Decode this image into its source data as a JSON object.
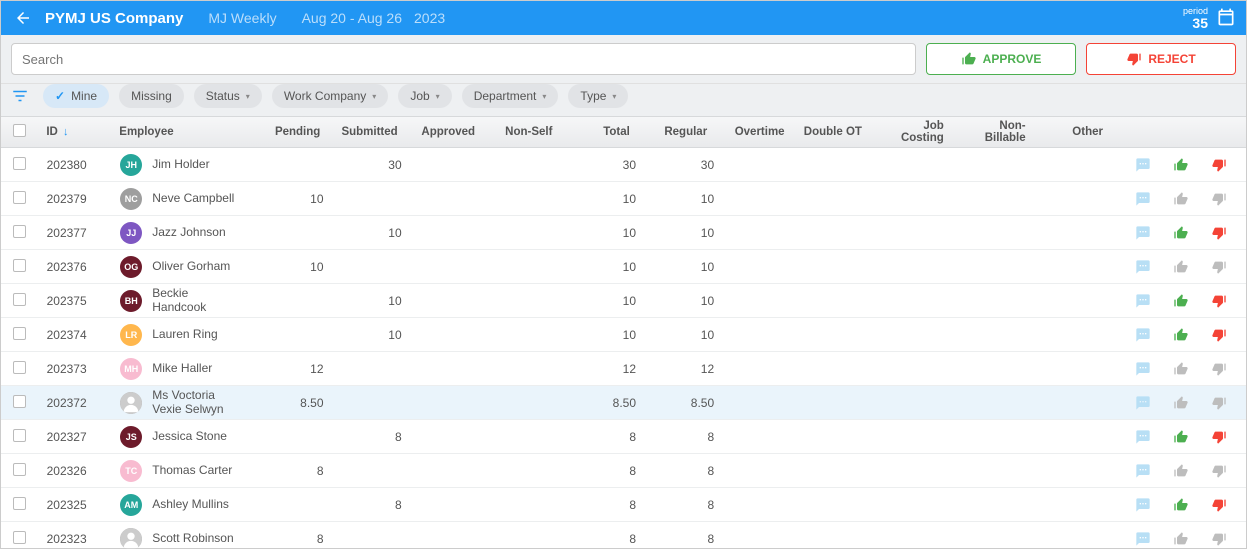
{
  "header": {
    "company": "PYMJ US Company",
    "period_name": "MJ Weekly",
    "date_range": "Aug 20 - Aug 26",
    "year": "2023",
    "period_label": "period",
    "period_number": "35"
  },
  "toolbar": {
    "search_placeholder": "Search",
    "approve_label": "APPROVE",
    "reject_label": "REJECT"
  },
  "filters": {
    "mine": "Mine",
    "chips": [
      {
        "label": "Missing",
        "dropdown": false
      },
      {
        "label": "Status",
        "dropdown": true
      },
      {
        "label": "Work Company",
        "dropdown": true
      },
      {
        "label": "Job",
        "dropdown": true
      },
      {
        "label": "Department",
        "dropdown": true
      },
      {
        "label": "Type",
        "dropdown": true
      }
    ]
  },
  "columns": {
    "id": "ID",
    "employee": "Employee",
    "pending": "Pending",
    "submitted": "Submitted",
    "approved": "Approved",
    "nonself": "Non-Self",
    "total": "Total",
    "regular": "Regular",
    "overtime": "Overtime",
    "doubleot": "Double OT",
    "jobcosting": "Job Costing",
    "nonbillable": "Non-Billable",
    "other": "Other"
  },
  "rows": [
    {
      "id": "202380",
      "initials": "JH",
      "name": "Jim Holder",
      "color": "#26a69a",
      "pending": "",
      "submitted": "30",
      "total": "30",
      "regular": "30",
      "up": true,
      "down": true,
      "photo": false
    },
    {
      "id": "202379",
      "initials": "NC",
      "name": "Neve Campbell",
      "color": "#9e9e9e",
      "pending": "10",
      "submitted": "",
      "total": "10",
      "regular": "10",
      "up": false,
      "down": false,
      "photo": false
    },
    {
      "id": "202377",
      "initials": "JJ",
      "name": "Jazz Johnson",
      "color": "#7e57c2",
      "pending": "",
      "submitted": "10",
      "total": "10",
      "regular": "10",
      "up": true,
      "down": true,
      "photo": false
    },
    {
      "id": "202376",
      "initials": "OG",
      "name": "Oliver Gorham",
      "color": "#6d1b2b",
      "pending": "10",
      "submitted": "",
      "total": "10",
      "regular": "10",
      "up": false,
      "down": false,
      "photo": false
    },
    {
      "id": "202375",
      "initials": "BH",
      "name": "Beckie Handcook",
      "color": "#6d1b2b",
      "pending": "",
      "submitted": "10",
      "total": "10",
      "regular": "10",
      "up": true,
      "down": true,
      "photo": false
    },
    {
      "id": "202374",
      "initials": "LR",
      "name": "Lauren Ring",
      "color": "#ffb74d",
      "pending": "",
      "submitted": "10",
      "total": "10",
      "regular": "10",
      "up": true,
      "down": true,
      "photo": false
    },
    {
      "id": "202373",
      "initials": "MH",
      "name": "Mike Haller",
      "color": "#f8bbd0",
      "pending": "12",
      "submitted": "",
      "total": "12",
      "regular": "12",
      "up": false,
      "down": false,
      "photo": false
    },
    {
      "id": "202372",
      "initials": "",
      "name": "Ms Voctoria Vexie Selwyn",
      "color": "#888",
      "pending": "8.50",
      "submitted": "",
      "total": "8.50",
      "regular": "8.50",
      "up": false,
      "down": false,
      "photo": true,
      "hover": true
    },
    {
      "id": "202327",
      "initials": "JS",
      "name": "Jessica Stone",
      "color": "#6d1b2b",
      "pending": "",
      "submitted": "8",
      "total": "8",
      "regular": "8",
      "up": true,
      "down": true,
      "photo": false
    },
    {
      "id": "202326",
      "initials": "TC",
      "name": "Thomas Carter",
      "color": "#f8bbd0",
      "pending": "8",
      "submitted": "",
      "total": "8",
      "regular": "8",
      "up": false,
      "down": false,
      "photo": false
    },
    {
      "id": "202325",
      "initials": "AM",
      "name": "Ashley Mullins",
      "color": "#26a69a",
      "pending": "",
      "submitted": "8",
      "total": "8",
      "regular": "8",
      "up": true,
      "down": true,
      "photo": false
    },
    {
      "id": "202323",
      "initials": "",
      "name": "Scott Robinson",
      "color": "#888",
      "pending": "8",
      "submitted": "",
      "total": "8",
      "regular": "8",
      "up": false,
      "down": false,
      "photo": true
    }
  ]
}
